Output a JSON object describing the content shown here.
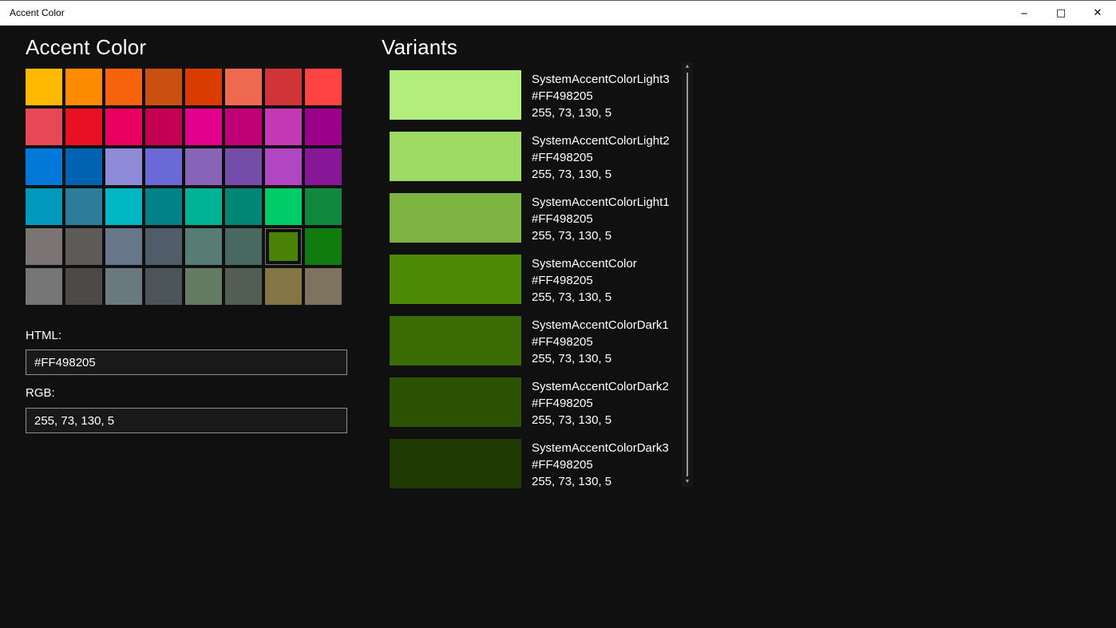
{
  "window": {
    "title": "Accent Color",
    "controls": {
      "minimize_icon": "─",
      "maximize_icon": "□",
      "close_icon": "✕"
    }
  },
  "left": {
    "heading": "Accent Color",
    "palette": {
      "columns": 8,
      "rows": 6,
      "selected_index": 38,
      "selected_color": "#498205",
      "colors": [
        "#FFB900",
        "#FF8C00",
        "#F7630C",
        "#CA5010",
        "#DA3B01",
        "#EF6950",
        "#D13438",
        "#FF4343",
        "#E74856",
        "#E81123",
        "#EA005E",
        "#C30052",
        "#E3008C",
        "#BF0077",
        "#C239B3",
        "#9A0089",
        "#0078D7",
        "#0063B1",
        "#8E8CD8",
        "#6B69D6",
        "#8764B8",
        "#744DA9",
        "#B146C2",
        "#881798",
        "#0099BC",
        "#2D7D9A",
        "#00B7C3",
        "#038387",
        "#00B294",
        "#018574",
        "#00CC6A",
        "#10893E",
        "#7A7574",
        "#5D5A58",
        "#68768A",
        "#515C6B",
        "#567C73",
        "#486860",
        "#498205",
        "#107C10",
        "#767676",
        "#4C4A48",
        "#69797E",
        "#4A5459",
        "#647C64",
        "#525E54",
        "#847545",
        "#7E735F"
      ]
    },
    "html_label": "HTML:",
    "html_value": "#FF498205",
    "rgb_label": "RGB:",
    "rgb_value": "255, 73, 130, 5"
  },
  "right": {
    "heading": "Variants",
    "scrollbar": {
      "up_icon": "▲",
      "down_icon": "▼"
    },
    "items": [
      {
        "name": "SystemAccentColorLight3",
        "hex": "#FF498205",
        "rgb": "255, 73, 130, 5",
        "color": "#B3EE7D"
      },
      {
        "name": "SystemAccentColorLight2",
        "hex": "#FF498205",
        "rgb": "255, 73, 130, 5",
        "color": "#9EDB64"
      },
      {
        "name": "SystemAccentColorLight1",
        "hex": "#FF498205",
        "rgb": "255, 73, 130, 5",
        "color": "#7DB340"
      },
      {
        "name": "SystemAccentColor",
        "hex": "#FF498205",
        "rgb": "255, 73, 130, 5",
        "color": "#4C8A06"
      },
      {
        "name": "SystemAccentColorDark1",
        "hex": "#FF498205",
        "rgb": "255, 73, 130, 5",
        "color": "#3B6B04"
      },
      {
        "name": "SystemAccentColorDark2",
        "hex": "#FF498205",
        "rgb": "255, 73, 130, 5",
        "color": "#2D5203"
      },
      {
        "name": "SystemAccentColorDark3",
        "hex": "#FF498205",
        "rgb": "255, 73, 130, 5",
        "color": "#1F3902"
      }
    ]
  }
}
